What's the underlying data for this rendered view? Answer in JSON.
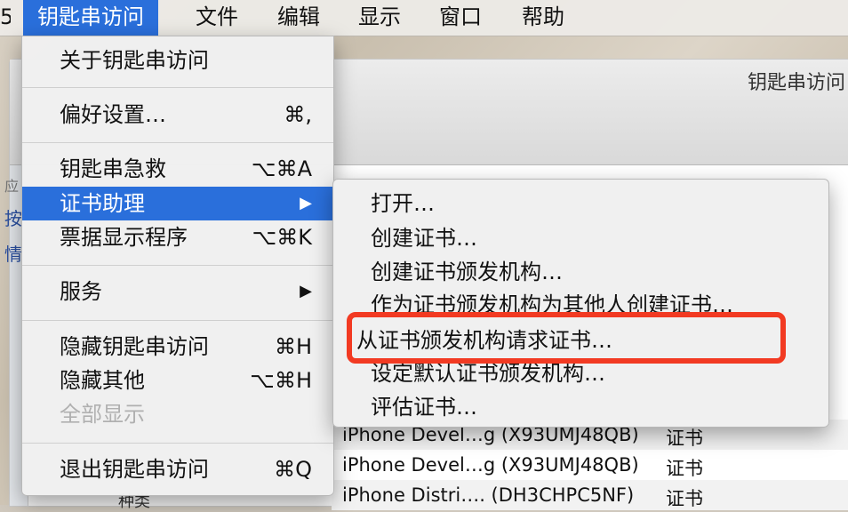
{
  "menubar": {
    "items": [
      "钥匙串访问",
      "文件",
      "编辑",
      "显示",
      "窗口",
      "帮助"
    ],
    "left_fragment": "5"
  },
  "app_menu": {
    "items": [
      {
        "label": "关于钥匙串访问",
        "shortcut": ""
      },
      {
        "label": "偏好设置…",
        "shortcut": "⌘,"
      },
      {
        "label": "钥匙串急救",
        "shortcut": "⌥⌘A"
      },
      {
        "label": "证书助理",
        "shortcut": "▶"
      },
      {
        "label": "票据显示程序",
        "shortcut": "⌥⌘K"
      },
      {
        "label": "服务",
        "shortcut": "▶"
      },
      {
        "label": "隐藏钥匙串访问",
        "shortcut": "⌘H"
      },
      {
        "label": "隐藏其他",
        "shortcut": "⌥⌘H"
      },
      {
        "label": "全部显示",
        "shortcut": ""
      },
      {
        "label": "退出钥匙串访问",
        "shortcut": "⌘Q"
      }
    ]
  },
  "cert_submenu": {
    "items": [
      "打开…",
      "创建证书…",
      "创建证书颁发机构…",
      "作为证书颁发机构为其他人创建证书…",
      "从证书颁发机构请求证书…",
      "设定默认证书颁发机构…",
      "评估证书…"
    ]
  },
  "window": {
    "title": "钥匙串访问",
    "sidebar_peek": [
      "应",
      "按",
      "情"
    ],
    "category_peek": "种类",
    "rows": [
      {
        "name": "iPhone Devel…g (X93UMJ48QB)",
        "kind": "证书"
      },
      {
        "name": "iPhone Devel…g (X93UMJ48QB)",
        "kind": "证书"
      },
      {
        "name": "iPhone Distri…. (DH3CHPC5NF)",
        "kind": "证书"
      }
    ]
  },
  "colors": {
    "highlight": "#2a6fdb",
    "annotation": "#f23a22"
  }
}
